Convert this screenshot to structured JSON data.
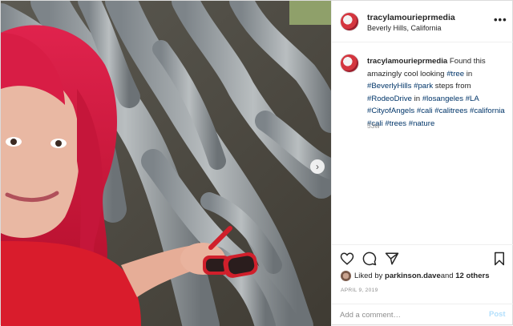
{
  "post": {
    "username": "tracylamourieprmedia",
    "location": "Beverly Hills, California",
    "more_icon": "•••",
    "caption": {
      "username": "tracylamourieprmedia",
      "text_1": " Found this amazingly cool looking ",
      "tag_tree": "#tree",
      "text_2": " in ",
      "tag_beverlyhills": "#BeverlyHills",
      "space_1": " ",
      "tag_park": "#park",
      "text_3": " steps from ",
      "tag_rodeodrive": "#RodeoDrive",
      "text_4": " in ",
      "tag_losangeles": "#losangeles",
      "space_2": " ",
      "tag_la": "#LA",
      "space_3": " ",
      "tag_cityofangels": "#CityofAngels",
      "space_4": " ",
      "tag_cali1": "#cali",
      "space_5": " ",
      "tag_calitrees": "#calitrees",
      "space_6": " ",
      "tag_california": "#california",
      "space_7": " ",
      "tag_cali2": "#cali",
      "space_8": " ",
      "tag_trees": "#trees",
      "space_9": " ",
      "tag_nature": "#nature"
    },
    "age": "53w",
    "liked_prefix": "Liked by ",
    "liked_user": "parkinson.dave",
    "liked_mid": " and ",
    "liked_others": "12 others",
    "date": "APRIL 9, 2019",
    "comment_placeholder": "Add a comment…",
    "post_label": "Post",
    "next_arrow": "›"
  },
  "icons": [
    "heart-icon",
    "comment-icon",
    "share-icon",
    "bookmark-icon",
    "chevron-right-icon"
  ],
  "colors": {
    "link": "#003569",
    "post_button": "#b2dffc",
    "muted": "#8e8e8e"
  }
}
